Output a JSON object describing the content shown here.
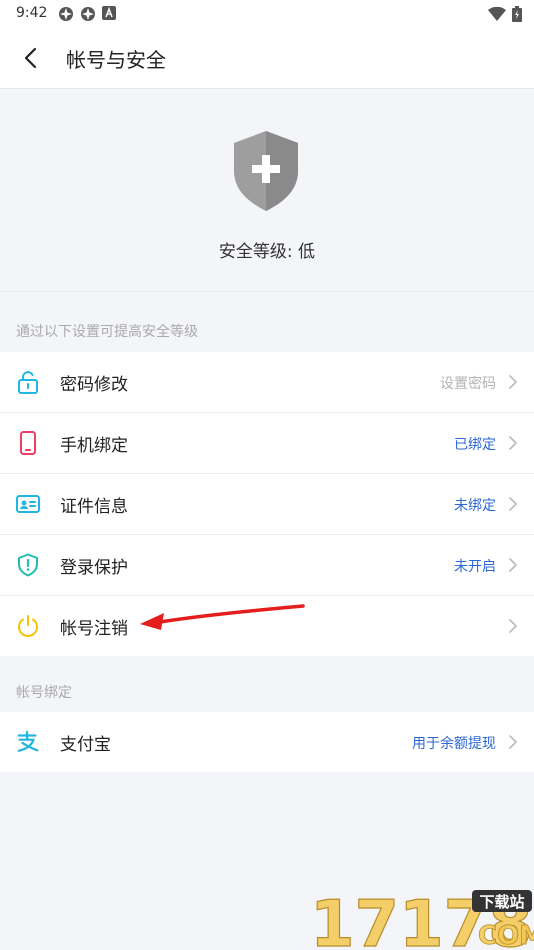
{
  "status_bar": {
    "time": "9:42"
  },
  "nav": {
    "title": "帐号与安全"
  },
  "hero": {
    "security_level": "安全等级: 低"
  },
  "section_security": {
    "header": "通过以下设置可提高安全等级",
    "items": [
      {
        "label": "密码修改",
        "status": "设置密码",
        "icon": "unlock-icon"
      },
      {
        "label": "手机绑定",
        "status": "已绑定",
        "icon": "phone-icon"
      },
      {
        "label": "证件信息",
        "status": "未绑定",
        "icon": "id-card-icon"
      },
      {
        "label": "登录保护",
        "status": "未开启",
        "icon": "shield-exclamation-icon"
      },
      {
        "label": "帐号注销",
        "status": "",
        "icon": "power-icon"
      }
    ]
  },
  "section_binding": {
    "header": "帐号绑定",
    "items": [
      {
        "label": "支付宝",
        "status": "用于余额提现",
        "icon": "alipay-icon"
      }
    ]
  },
  "watermark": {
    "number": "17178",
    "badge": "下载站",
    "domain": "COM"
  },
  "colors": {
    "blue_status": "#2b67d6",
    "gray_status": "#b3b3b3",
    "icon_cyan": "#21b6e0",
    "icon_pink": "#ef3d68",
    "icon_yellow": "#f5c400",
    "arrow_red": "#e41d1d"
  }
}
